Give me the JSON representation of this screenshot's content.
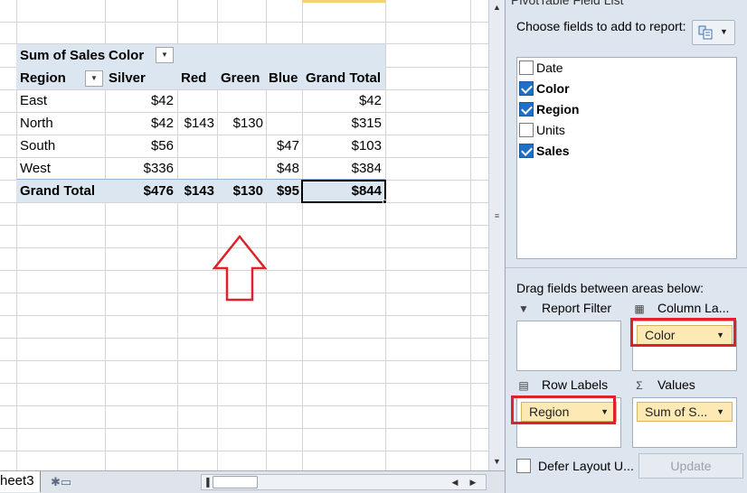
{
  "sheet": {
    "tab_name": "heet3",
    "pivot": {
      "corner_label": "Sum of Sales",
      "col_field_label": "Color",
      "row_field_label": "Region",
      "columns": [
        "Silver",
        "Red",
        "Green",
        "Blue",
        "Grand Total"
      ],
      "rows": [
        {
          "label": "East",
          "cells": [
            "$42",
            "",
            "",
            "",
            "$42"
          ]
        },
        {
          "label": "North",
          "cells": [
            "$42",
            "$143",
            "$130",
            "",
            "$315"
          ]
        },
        {
          "label": "South",
          "cells": [
            "$56",
            "",
            "",
            "$47",
            "$103"
          ]
        },
        {
          "label": "West",
          "cells": [
            "$336",
            "",
            "",
            "$48",
            "$384"
          ]
        }
      ],
      "total": {
        "label": "Grand Total",
        "cells": [
          "$476",
          "$143",
          "$130",
          "$95",
          "$844"
        ]
      }
    },
    "annotation_color": "#e0202a"
  },
  "pane": {
    "title": "PivotTable Field List",
    "choose_label": "Choose fields to add to report:",
    "fields": [
      {
        "name": "Date",
        "checked": false
      },
      {
        "name": "Color",
        "checked": true
      },
      {
        "name": "Region",
        "checked": true
      },
      {
        "name": "Units",
        "checked": false
      },
      {
        "name": "Sales",
        "checked": true
      }
    ],
    "drag_label": "Drag fields between areas below:",
    "areas": {
      "report_filter": {
        "label": "Report Filter",
        "items": []
      },
      "column_labels": {
        "label": "Column La...",
        "items": [
          "Color"
        ]
      },
      "row_labels": {
        "label": "Row Labels",
        "items": [
          "Region"
        ]
      },
      "values": {
        "label": "Values",
        "items": [
          "Sum of S..."
        ]
      }
    },
    "defer_label": "Defer Layout U...",
    "update_label": "Update"
  }
}
